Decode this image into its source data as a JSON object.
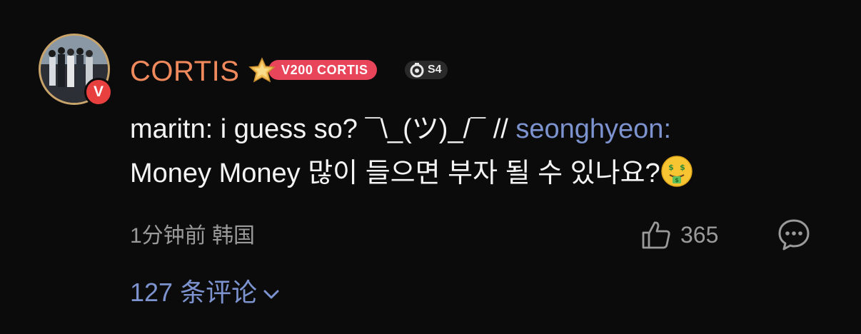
{
  "user": {
    "name": "CORTIS",
    "verified_mark": "V",
    "level_badge": "V200 CORTIS",
    "season_badge": "S4"
  },
  "comment": {
    "text_part1": "maritn: i guess so? ¯\\_(ツ)_/¯ // ",
    "mention": "seonghyeon:",
    "text_part2": "Money Money 많이 들으면 부자 될 수 있나요?",
    "emoji": "money-mouth-face"
  },
  "meta": {
    "time_location": "1分钟前 韩国",
    "likes": "365"
  },
  "replies": {
    "label": "127 条评论"
  },
  "colors": {
    "username": "#f08a5d",
    "mention": "#7d93cf",
    "badge": "#e8445a",
    "background": "#0b0b0b"
  }
}
